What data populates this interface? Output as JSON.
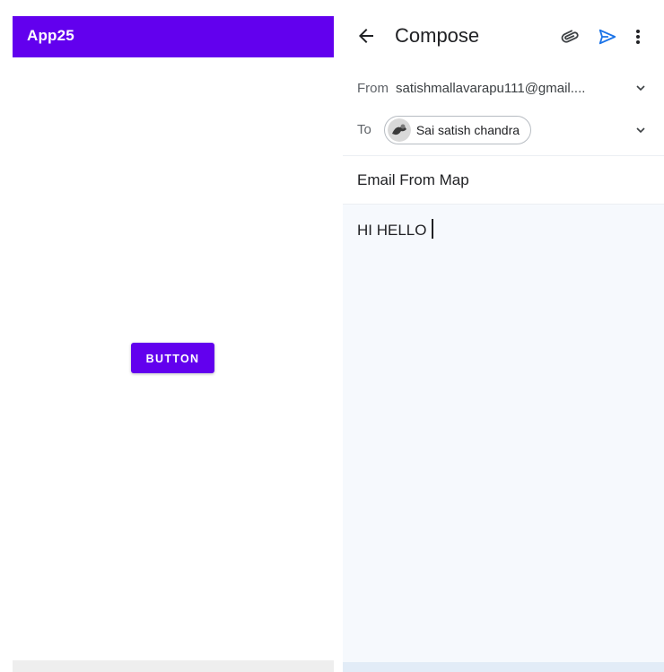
{
  "left_app": {
    "title": "App25",
    "button_label": "BUTTON",
    "accent_color": "#6200ee"
  },
  "compose": {
    "title": "Compose",
    "icons": {
      "back": "arrow-left-icon",
      "attach": "paperclip-icon",
      "send": "send-icon",
      "more": "more-vert-icon"
    },
    "from": {
      "label": "From",
      "value": "satishmallavarapu111@gmail...."
    },
    "to": {
      "label": "To",
      "recipient": "Sai satish chandra"
    },
    "subject": "Email From Map",
    "body": "HI HELLO",
    "send_color": "#1a73e8"
  }
}
